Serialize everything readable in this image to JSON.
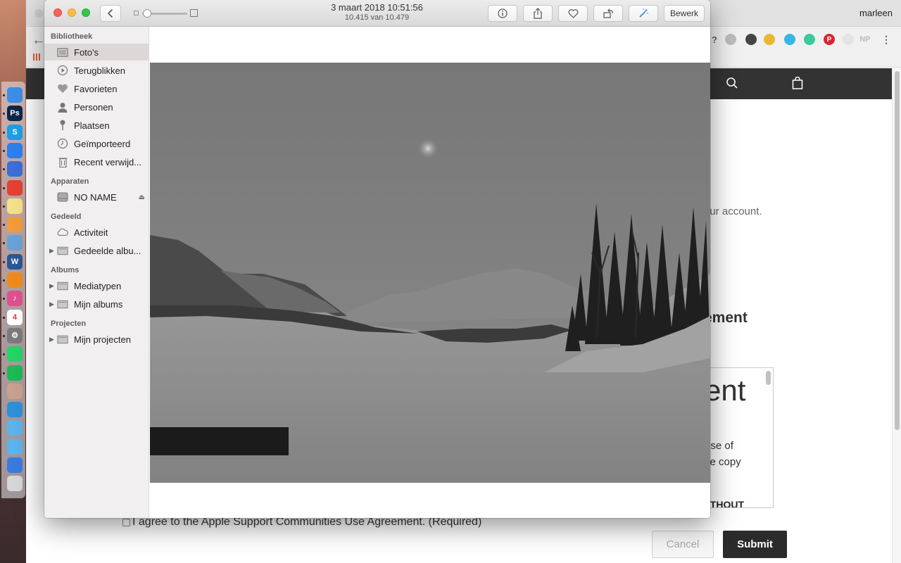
{
  "browser": {
    "user_name": "marleen",
    "page": {
      "text_account": "our account.",
      "heading_partial": "ement",
      "agreement_large": "ent",
      "agreement_line1": "use of",
      "agreement_line2": "ce copy",
      "agreement_caps": "/ITHOUT",
      "agree_label": "I agree to the Apple Support Communities Use Agreement. (Required)",
      "cancel_label": "Cancel",
      "submit_label": "Submit"
    }
  },
  "photos": {
    "date": "3 maart 2018 10:51:56",
    "count": "10.415 van 10.479",
    "edit_label": "Bewerk",
    "sidebar": {
      "sections": [
        {
          "title": "Bibliotheek",
          "items": [
            {
              "label": "Foto's",
              "icon": "photos-icon",
              "selected": true
            },
            {
              "label": "Terugblikken",
              "icon": "memories-icon"
            },
            {
              "label": "Favorieten",
              "icon": "heart-icon"
            },
            {
              "label": "Personen",
              "icon": "person-icon"
            },
            {
              "label": "Plaatsen",
              "icon": "pin-icon"
            },
            {
              "label": "Geïmporteerd",
              "icon": "clock-icon"
            },
            {
              "label": "Recent verwijd...",
              "icon": "trash-icon"
            }
          ]
        },
        {
          "title": "Apparaten",
          "items": [
            {
              "label": "NO NAME",
              "icon": "drive-icon",
              "eject": true
            }
          ]
        },
        {
          "title": "Gedeeld",
          "items": [
            {
              "label": "Activiteit",
              "icon": "cloud-icon"
            },
            {
              "label": "Gedeelde albu...",
              "icon": "folder-icon",
              "disclosure": true
            }
          ]
        },
        {
          "title": "Albums",
          "items": [
            {
              "label": "Mediatypen",
              "icon": "folder-icon",
              "disclosure": true
            },
            {
              "label": "Mijn albums",
              "icon": "folder-icon",
              "disclosure": true
            }
          ]
        },
        {
          "title": "Projecten",
          "items": [
            {
              "label": "Mijn projecten",
              "icon": "folder-icon",
              "disclosure": true
            }
          ]
        }
      ]
    }
  },
  "dock": {
    "icons": [
      {
        "name": "finder-icon",
        "color": "#3d8ee8",
        "glyph": ""
      },
      {
        "name": "photoshop-icon",
        "color": "#0b2748",
        "glyph": "Ps"
      },
      {
        "name": "skype-icon",
        "color": "#1aa0e6",
        "glyph": "S"
      },
      {
        "name": "safari-icon",
        "color": "#2d7ff0",
        "glyph": ""
      },
      {
        "name": "launchpad-icon",
        "color": "#3b6fd6",
        "glyph": ""
      },
      {
        "name": "chrome-icon",
        "color": "#e44134",
        "glyph": ""
      },
      {
        "name": "notes-icon",
        "color": "#f4e08a",
        "glyph": ""
      },
      {
        "name": "photos-app-icon",
        "color": "#f29b3a",
        "glyph": ""
      },
      {
        "name": "preview-icon",
        "color": "#6aa1d6",
        "glyph": ""
      },
      {
        "name": "word-icon",
        "color": "#2b5797",
        "glyph": "W"
      },
      {
        "name": "vlc-icon",
        "color": "#f08a1c",
        "glyph": ""
      },
      {
        "name": "itunes-icon",
        "color": "#e0508f",
        "glyph": "♪"
      },
      {
        "name": "calendar-icon",
        "color": "#ffffff",
        "glyph": "4"
      },
      {
        "name": "system-preferences-icon",
        "color": "#7a7a7a",
        "glyph": "⚙"
      },
      {
        "name": "whatsapp-icon",
        "color": "#25d366",
        "glyph": ""
      },
      {
        "name": "spotify-icon",
        "color": "#1db954",
        "glyph": ""
      },
      {
        "name": "contact-photo-icon",
        "color": "#c9a08e",
        "glyph": ""
      },
      {
        "name": "screen-sharing-icon",
        "color": "#2f8fd8",
        "glyph": ""
      },
      {
        "name": "applications-folder-icon",
        "color": "#5db3ea",
        "glyph": ""
      },
      {
        "name": "documents-folder-icon",
        "color": "#5db3ea",
        "glyph": ""
      },
      {
        "name": "network-icon",
        "color": "#3a7be0",
        "glyph": ""
      },
      {
        "name": "trash-dock-icon",
        "color": "#d6d6d6",
        "glyph": ""
      }
    ]
  }
}
